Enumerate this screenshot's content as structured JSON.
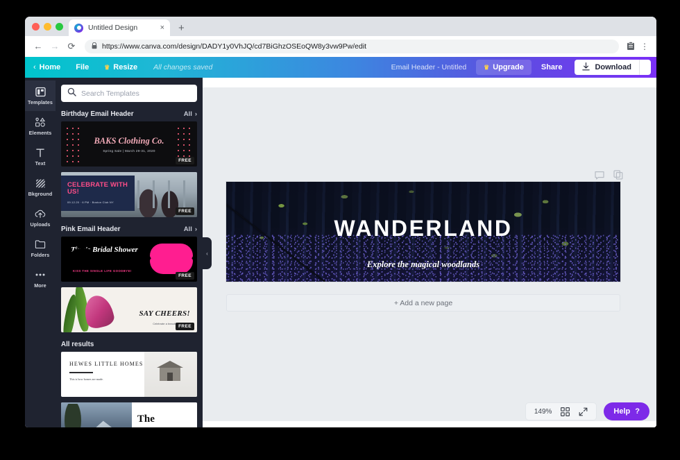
{
  "browser": {
    "tab": {
      "title": "Untitled Design",
      "favicon": "canva-favicon",
      "close": "×"
    },
    "new_tab": "+",
    "nav": {
      "back": "←",
      "forward": "→",
      "reload": "⟳"
    },
    "address": {
      "lock_icon": "lock-icon",
      "url": "https://www.canva.com/design/DADY1y0VhJQ/cd7BiGhzOSEoQW8y3vw9Pw/edit"
    },
    "extension_icon": "clipboard-icon",
    "menu_icon": "⋮"
  },
  "topbar": {
    "home": "Home",
    "home_chevron": "‹",
    "file": "File",
    "resize": "Resize",
    "resize_crown": "♛",
    "status": "All changes saved",
    "doc_name": "Email Header - Untitled",
    "upgrade": "Upgrade",
    "upgrade_crown": "♛",
    "share": "Share",
    "download": "Download",
    "download_caret": "ⱟ",
    "gradient_from": "#00c4cc",
    "gradient_to": "#7b2ff7"
  },
  "rail": {
    "items": [
      {
        "label": "Templates",
        "icon": "templates-icon",
        "active": true
      },
      {
        "label": "Elements",
        "icon": "elements-icon",
        "active": false
      },
      {
        "label": "Text",
        "icon": "text-icon",
        "active": false
      },
      {
        "label": "Bkground",
        "icon": "background-icon",
        "active": false
      },
      {
        "label": "Uploads",
        "icon": "uploads-icon",
        "active": false
      },
      {
        "label": "Folders",
        "icon": "folders-icon",
        "active": false
      },
      {
        "label": "More",
        "icon": "more-icon",
        "active": false
      }
    ]
  },
  "panel": {
    "search": {
      "placeholder": "Search Templates",
      "value": "",
      "icon": "search-icon"
    },
    "sections": [
      {
        "title": "Birthday Email Header",
        "all": "All",
        "all_chevron": "›"
      },
      {
        "title": "Pink Email Header",
        "all": "All",
        "all_chevron": "›"
      },
      {
        "title": "All results",
        "all": "",
        "all_chevron": ""
      }
    ],
    "templates": {
      "baks": {
        "title": "BAKS Clothing Co.",
        "subtitle": "Spring Sale | March 29-31, 2020",
        "badge": "FREE"
      },
      "celebrate": {
        "title": "CELEBRATE WITH US!",
        "subtitle": "09.12.20 · 6 PM · Boston Club NY",
        "badge": "FREE"
      },
      "tina": {
        "title": "Tina's Bridal Shower",
        "subtitle": "KISS THE SINGLE LIFE GOODBYE!",
        "badge": "FREE"
      },
      "cheers": {
        "title": "SAY CHEERS!",
        "subtitle": "Celebrate a beautiful instant",
        "badge": "FREE"
      },
      "hewes": {
        "title": "HEWES LITTLE HOMES",
        "subtitle": "This is how homes are made."
      },
      "the": {
        "title": "The"
      }
    },
    "collapse_chevron": "‹"
  },
  "editor": {
    "page_tools": [
      {
        "icon": "comment-icon"
      },
      {
        "icon": "duplicate-icon"
      }
    ],
    "design": {
      "title": "WANDERLAND",
      "subtitle": "Explore the magical woodlands"
    },
    "add_page": "+ Add a new page",
    "zoom": "149%",
    "grid_icon": "grid-icon",
    "expand_icon": "expand-icon",
    "help": "Help",
    "help_mark": "?",
    "help_color": "#7d2ae8"
  }
}
